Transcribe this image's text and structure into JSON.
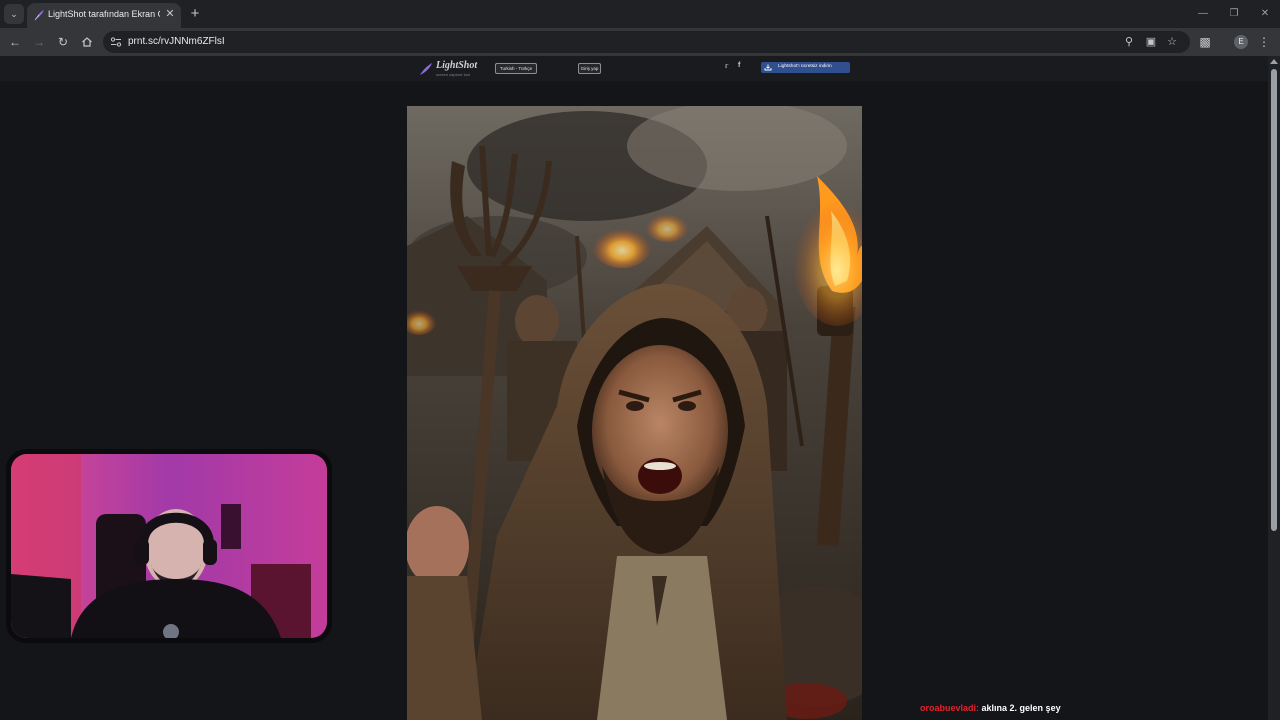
{
  "browser": {
    "tab": {
      "title": "LightShot tarafından Ekran Görüntüsü",
      "favicon": "lightshot-feather-icon"
    },
    "address_bar": {
      "url": "prnt.sc/rvJNNm6ZFlsI"
    }
  },
  "lightshot": {
    "logo_text": "LightShot",
    "tagline": "screen capture tool",
    "language_button": "Turkish - Türkçe",
    "login_button": "Giriş yap",
    "install_button": "Lightshot'ı ücretsiz indirin"
  },
  "screenshot": {
    "subject": "angry hooded villager with pitchfork and torch"
  },
  "chat": {
    "username": "oroabuevladi:",
    "message": "aklına 2. gelen şey"
  },
  "colors": {
    "chat_username": "#e0232f",
    "install_button": "#2f4f8f"
  }
}
